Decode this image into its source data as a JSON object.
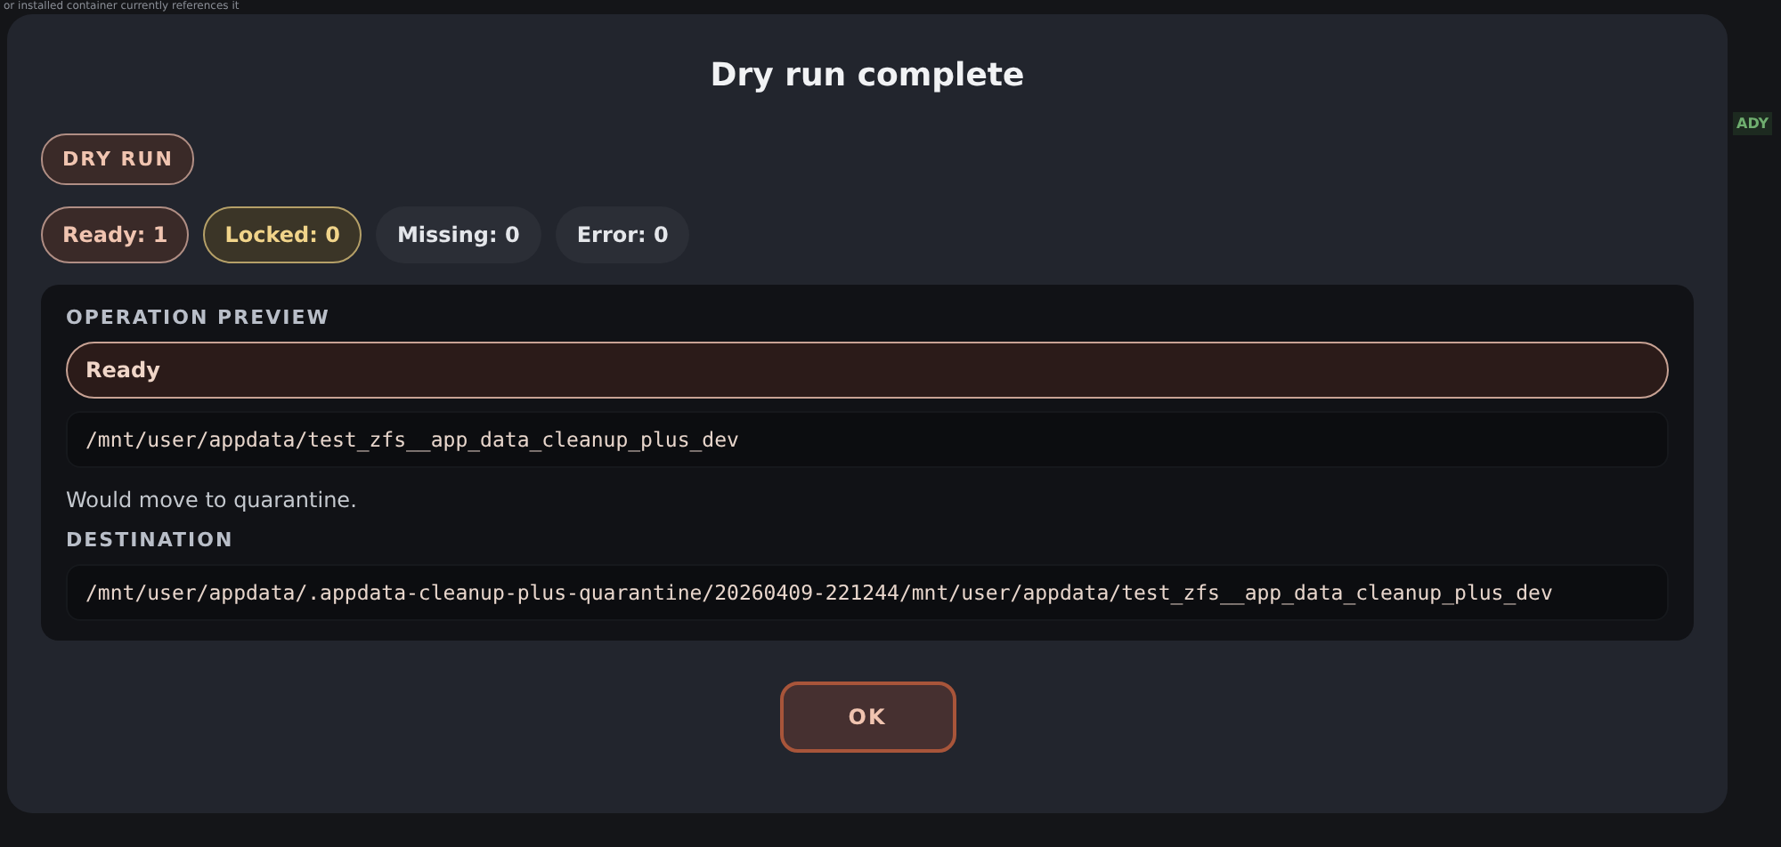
{
  "background": {
    "note": "or installed container currently references it",
    "badge": "ADY"
  },
  "dialog": {
    "title": "Dry run complete",
    "mode_badge": "DRY RUN",
    "counts": [
      {
        "label": "Ready: 1",
        "kind": "ready"
      },
      {
        "label": "Locked: 0",
        "kind": "locked"
      },
      {
        "label": "Missing: 0",
        "kind": "plain"
      },
      {
        "label": "Error: 0",
        "kind": "plain"
      }
    ],
    "preview": {
      "heading": "OPERATION PREVIEW",
      "status": "Ready",
      "source": "/mnt/user/appdata/test_zfs__app_data_cleanup_plus_dev",
      "message": "Would move to quarantine.",
      "destination_heading": "DESTINATION",
      "destination": "/mnt/user/appdata/.appdata-cleanup-plus-quarantine/20260409-221244/mnt/user/appdata/test_zfs__app_data_cleanup_plus_dev"
    },
    "buttons": [
      "OK"
    ]
  }
}
